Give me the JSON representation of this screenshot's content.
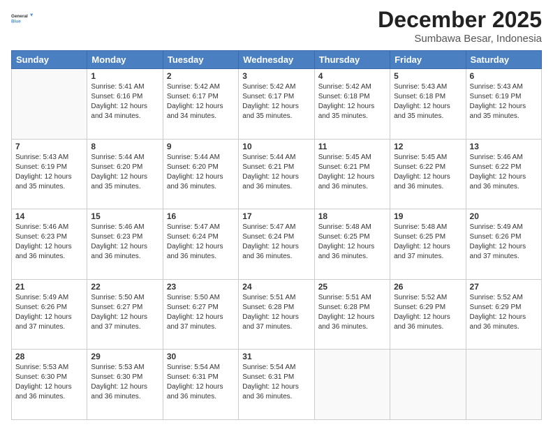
{
  "header": {
    "logo_line1": "General",
    "logo_line2": "Blue",
    "month_year": "December 2025",
    "location": "Sumbawa Besar, Indonesia"
  },
  "days_of_week": [
    "Sunday",
    "Monday",
    "Tuesday",
    "Wednesday",
    "Thursday",
    "Friday",
    "Saturday"
  ],
  "weeks": [
    [
      {
        "day": "",
        "info": ""
      },
      {
        "day": "1",
        "info": "Sunrise: 5:41 AM\nSunset: 6:16 PM\nDaylight: 12 hours\nand 34 minutes."
      },
      {
        "day": "2",
        "info": "Sunrise: 5:42 AM\nSunset: 6:17 PM\nDaylight: 12 hours\nand 34 minutes."
      },
      {
        "day": "3",
        "info": "Sunrise: 5:42 AM\nSunset: 6:17 PM\nDaylight: 12 hours\nand 35 minutes."
      },
      {
        "day": "4",
        "info": "Sunrise: 5:42 AM\nSunset: 6:18 PM\nDaylight: 12 hours\nand 35 minutes."
      },
      {
        "day": "5",
        "info": "Sunrise: 5:43 AM\nSunset: 6:18 PM\nDaylight: 12 hours\nand 35 minutes."
      },
      {
        "day": "6",
        "info": "Sunrise: 5:43 AM\nSunset: 6:19 PM\nDaylight: 12 hours\nand 35 minutes."
      }
    ],
    [
      {
        "day": "7",
        "info": "Sunrise: 5:43 AM\nSunset: 6:19 PM\nDaylight: 12 hours\nand 35 minutes."
      },
      {
        "day": "8",
        "info": "Sunrise: 5:44 AM\nSunset: 6:20 PM\nDaylight: 12 hours\nand 35 minutes."
      },
      {
        "day": "9",
        "info": "Sunrise: 5:44 AM\nSunset: 6:20 PM\nDaylight: 12 hours\nand 36 minutes."
      },
      {
        "day": "10",
        "info": "Sunrise: 5:44 AM\nSunset: 6:21 PM\nDaylight: 12 hours\nand 36 minutes."
      },
      {
        "day": "11",
        "info": "Sunrise: 5:45 AM\nSunset: 6:21 PM\nDaylight: 12 hours\nand 36 minutes."
      },
      {
        "day": "12",
        "info": "Sunrise: 5:45 AM\nSunset: 6:22 PM\nDaylight: 12 hours\nand 36 minutes."
      },
      {
        "day": "13",
        "info": "Sunrise: 5:46 AM\nSunset: 6:22 PM\nDaylight: 12 hours\nand 36 minutes."
      }
    ],
    [
      {
        "day": "14",
        "info": "Sunrise: 5:46 AM\nSunset: 6:23 PM\nDaylight: 12 hours\nand 36 minutes."
      },
      {
        "day": "15",
        "info": "Sunrise: 5:46 AM\nSunset: 6:23 PM\nDaylight: 12 hours\nand 36 minutes."
      },
      {
        "day": "16",
        "info": "Sunrise: 5:47 AM\nSunset: 6:24 PM\nDaylight: 12 hours\nand 36 minutes."
      },
      {
        "day": "17",
        "info": "Sunrise: 5:47 AM\nSunset: 6:24 PM\nDaylight: 12 hours\nand 36 minutes."
      },
      {
        "day": "18",
        "info": "Sunrise: 5:48 AM\nSunset: 6:25 PM\nDaylight: 12 hours\nand 36 minutes."
      },
      {
        "day": "19",
        "info": "Sunrise: 5:48 AM\nSunset: 6:25 PM\nDaylight: 12 hours\nand 37 minutes."
      },
      {
        "day": "20",
        "info": "Sunrise: 5:49 AM\nSunset: 6:26 PM\nDaylight: 12 hours\nand 37 minutes."
      }
    ],
    [
      {
        "day": "21",
        "info": "Sunrise: 5:49 AM\nSunset: 6:26 PM\nDaylight: 12 hours\nand 37 minutes."
      },
      {
        "day": "22",
        "info": "Sunrise: 5:50 AM\nSunset: 6:27 PM\nDaylight: 12 hours\nand 37 minutes."
      },
      {
        "day": "23",
        "info": "Sunrise: 5:50 AM\nSunset: 6:27 PM\nDaylight: 12 hours\nand 37 minutes."
      },
      {
        "day": "24",
        "info": "Sunrise: 5:51 AM\nSunset: 6:28 PM\nDaylight: 12 hours\nand 37 minutes."
      },
      {
        "day": "25",
        "info": "Sunrise: 5:51 AM\nSunset: 6:28 PM\nDaylight: 12 hours\nand 36 minutes."
      },
      {
        "day": "26",
        "info": "Sunrise: 5:52 AM\nSunset: 6:29 PM\nDaylight: 12 hours\nand 36 minutes."
      },
      {
        "day": "27",
        "info": "Sunrise: 5:52 AM\nSunset: 6:29 PM\nDaylight: 12 hours\nand 36 minutes."
      }
    ],
    [
      {
        "day": "28",
        "info": "Sunrise: 5:53 AM\nSunset: 6:30 PM\nDaylight: 12 hours\nand 36 minutes."
      },
      {
        "day": "29",
        "info": "Sunrise: 5:53 AM\nSunset: 6:30 PM\nDaylight: 12 hours\nand 36 minutes."
      },
      {
        "day": "30",
        "info": "Sunrise: 5:54 AM\nSunset: 6:31 PM\nDaylight: 12 hours\nand 36 minutes."
      },
      {
        "day": "31",
        "info": "Sunrise: 5:54 AM\nSunset: 6:31 PM\nDaylight: 12 hours\nand 36 minutes."
      },
      {
        "day": "",
        "info": ""
      },
      {
        "day": "",
        "info": ""
      },
      {
        "day": "",
        "info": ""
      }
    ]
  ]
}
